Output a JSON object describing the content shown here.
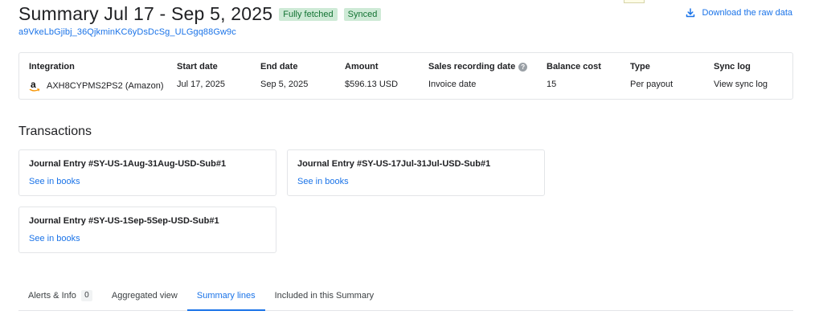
{
  "header": {
    "title": "Summary Jul 17 - Sep 5, 2025",
    "badges": [
      "Fully fetched",
      "Synced"
    ],
    "summary_id": "a9VkeLbGjibj_36QjkminKC6yDsDcSg_ULGgq88Gw9c",
    "download_label": "Download the raw data"
  },
  "info": {
    "headers": {
      "integration": "Integration",
      "start_date": "Start date",
      "end_date": "End date",
      "amount": "Amount",
      "sales_recording_date": "Sales recording date",
      "balance_cost": "Balance cost",
      "type": "Type",
      "sync_log": "Sync log"
    },
    "values": {
      "integration": "AXH8CYPMS2PS2 (Amazon)",
      "start_date": "Jul 17, 2025",
      "end_date": "Sep 5, 2025",
      "amount": "$596.13 USD",
      "sales_recording_date": "Invoice date",
      "balance_cost": "15",
      "type": "Per payout",
      "sync_log": "View sync log"
    }
  },
  "transactions": {
    "title": "Transactions",
    "entries": [
      {
        "title": "Journal Entry #SY-US-1Aug-31Aug-USD-Sub#1",
        "link": "See in books"
      },
      {
        "title": "Journal Entry #SY-US-17Jul-31Jul-USD-Sub#1",
        "link": "See in books"
      },
      {
        "title": "Journal Entry #SY-US-1Sep-5Sep-USD-Sub#1",
        "link": "See in books"
      }
    ]
  },
  "tabs": {
    "items": [
      {
        "label": "Alerts & Info",
        "count": "0"
      },
      {
        "label": "Aggregated view"
      },
      {
        "label": "Summary lines",
        "active": true
      },
      {
        "label": "Included in this Summary"
      }
    ]
  },
  "icons": {
    "download": "download-icon",
    "help": "help-icon",
    "amazon": "amazon-logo"
  },
  "colors": {
    "accent": "#1a73e8",
    "badge_bg": "#ceead6",
    "badge_text": "#137333",
    "border": "#e3e5e8"
  }
}
